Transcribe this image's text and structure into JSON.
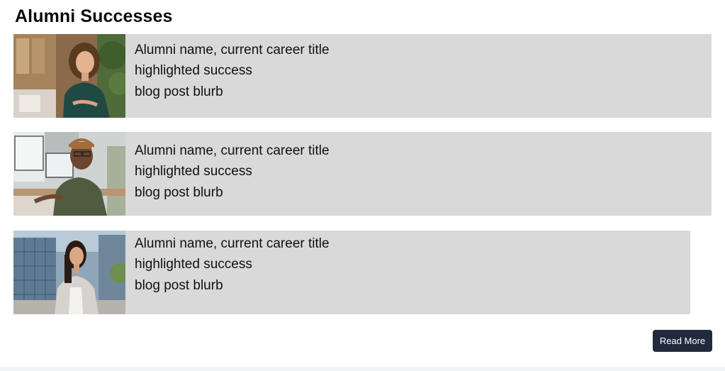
{
  "page": {
    "title": "Alumni Successes"
  },
  "alumni": [
    {
      "name_title": "Alumni name, current career title",
      "success": "highlighted success",
      "blurb": "blog post blurb",
      "photo": "smiling-woman-curly-hair-office"
    },
    {
      "name_title": "Alumni name, current career title",
      "success": "highlighted success",
      "blurb": "blog post blurb",
      "photo": "man-beanie-at-desk"
    },
    {
      "name_title": "Alumni name, current career title",
      "success": "highlighted success",
      "blurb": "blog post blurb",
      "photo": "woman-blazer-outdoors-city"
    }
  ],
  "actions": {
    "read_more_label": "Read More"
  },
  "colors": {
    "card_background": "#d9d9d9",
    "button_background": "#202a3c",
    "button_text": "#ffffff"
  }
}
